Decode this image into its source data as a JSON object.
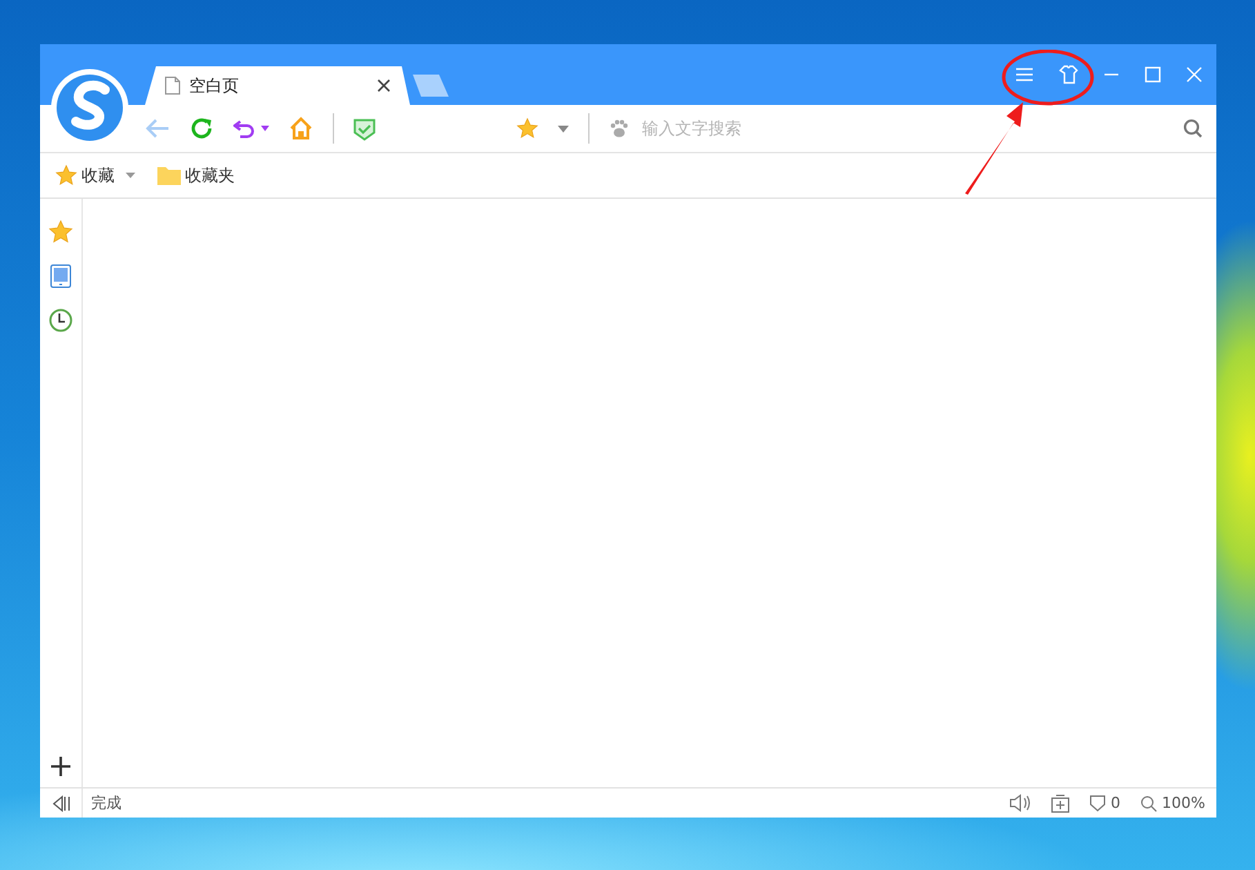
{
  "tab": {
    "title": "空白页",
    "selected": true
  },
  "toolbar": {
    "search": {
      "placeholder": "输入文字搜索"
    }
  },
  "bookmarks_bar": [
    {
      "kind": "menu",
      "label": "收藏"
    },
    {
      "kind": "folder",
      "label": "收藏夹"
    }
  ],
  "status_bar": {
    "status": "完成",
    "blocked_count": "0",
    "zoom": "100%"
  }
}
